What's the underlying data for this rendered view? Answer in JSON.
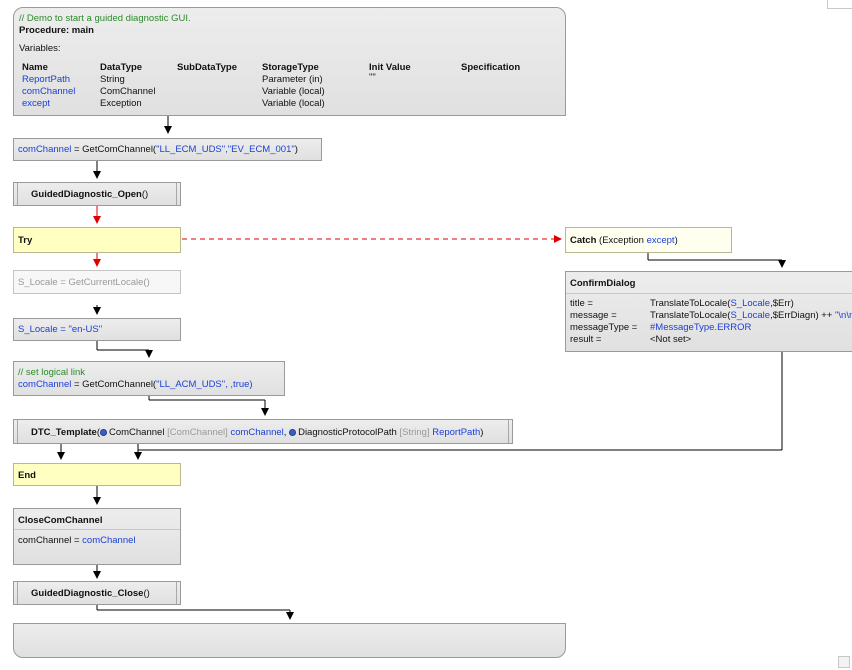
{
  "procedure": {
    "comment": "// Demo to start a guided diagnostic GUI.",
    "title": "Procedure: main",
    "variables_label": "Variables:",
    "headers": [
      "Name",
      "DataType",
      "SubDataType",
      "StorageType",
      "Init Value",
      "Specification"
    ],
    "rows": [
      {
        "name": "ReportPath",
        "type": "String",
        "storage": "Parameter (in)",
        "init": "\"\""
      },
      {
        "name": "comChannel",
        "type": "ComChannel",
        "storage": "Variable (local)",
        "init": ""
      },
      {
        "name": "except",
        "type": "Exception",
        "storage": "Variable (local)",
        "init": ""
      }
    ]
  },
  "step_getcom1": {
    "lhs": "comChannel",
    "eq": " = GetComChannel(",
    "args": "\"LL_ECM_UDS\",\"EV_ECM_001\"",
    "close": ")"
  },
  "step_gd_open": {
    "label": "GuidedDiagnostic_Open",
    "parens": "()"
  },
  "step_try": {
    "label": "Try"
  },
  "step_catch": {
    "label": "Catch",
    "paren_open": " (Exception ",
    "var": "except",
    "paren_close": ")"
  },
  "step_locale_get": {
    "text": "S_Locale = GetCurrentLocale()"
  },
  "step_locale_set": {
    "lhs": "S_Locale",
    "rhs": " = \"en-US\""
  },
  "step_getcom2": {
    "comment": "// set logical link",
    "lhs": "comChannel",
    "eq": " = GetComChannel(",
    "args": "\"LL_ACM_UDS\",",
    "rest": "  ,true)"
  },
  "step_dtc": {
    "name": "DTC_Template",
    "open": "(",
    "p1_name": "ComChannel",
    "p1_type": " [ComChannel] ",
    "p1_value": "comChannel",
    "p2_name": "DiagnosticProtocolPath",
    "p2_type": " [String] ",
    "p2_value": "ReportPath",
    "close": ")"
  },
  "step_end": {
    "label": "End"
  },
  "step_close": {
    "title": "CloseComChannel",
    "lhs": "comChannel = ",
    "rhs": "comChannel"
  },
  "step_gd_close": {
    "label": "GuidedDiagnostic_Close",
    "parens": "()"
  },
  "confirm": {
    "title": "ConfirmDialog",
    "rows": [
      {
        "key": "title =",
        "value_pre": "TranslateToLocale(",
        "value_var": "S_Locale",
        "value_post": ",$Err)",
        "value_str": ""
      },
      {
        "key": "message =",
        "value_pre": "TranslateToLocale(",
        "value_var": "S_Locale",
        "value_post": ",$ErrDiagn) ++ ",
        "value_str": "\"\\n\\n\" +"
      },
      {
        "key": "messageType =",
        "value_pre": "",
        "value_var": "#MessageType.ERROR",
        "value_post": "",
        "value_str": ""
      },
      {
        "key": "result =",
        "value_pre": "<Not set>",
        "value_var": "",
        "value_post": "",
        "value_str": ""
      }
    ]
  },
  "colors": {
    "link_blue": "#1a3fd6",
    "comment_green": "#2b8a2b",
    "try_yellow": "#ffffc2",
    "arrow_red": "#e00000"
  }
}
